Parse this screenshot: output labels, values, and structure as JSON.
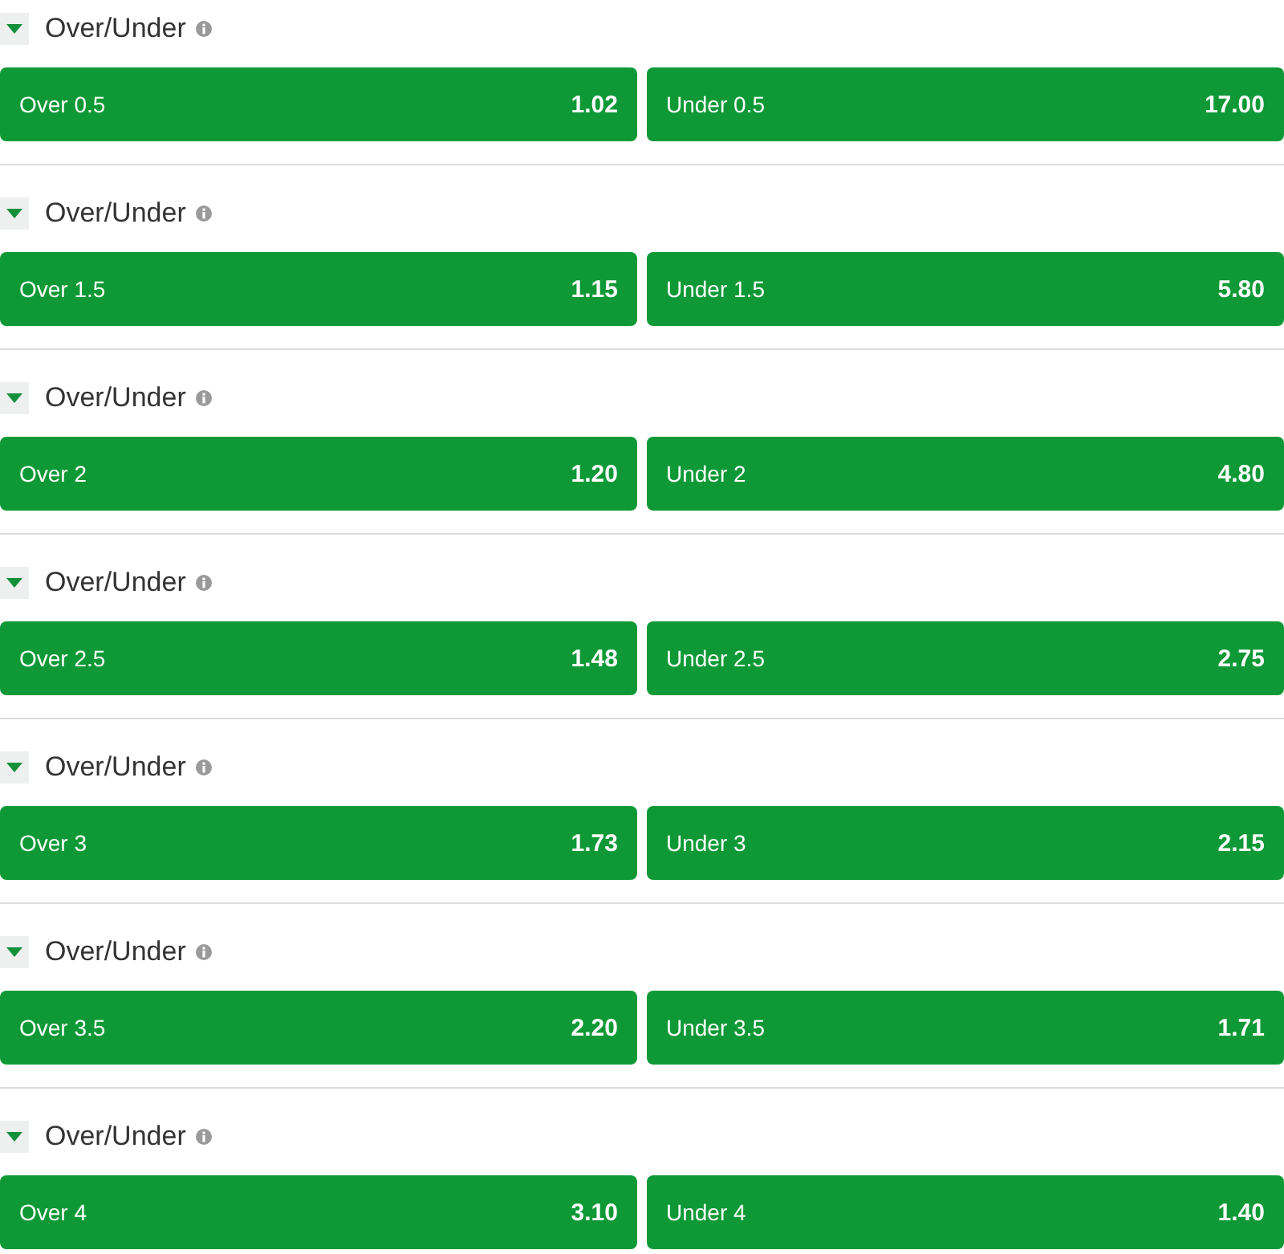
{
  "markets": [
    {
      "title": "Over/Under",
      "expanded": true,
      "outcomes": [
        {
          "label": "Over 0.5",
          "odds": "1.02"
        },
        {
          "label": "Under 0.5",
          "odds": "17.00"
        }
      ]
    },
    {
      "title": "Over/Under",
      "expanded": true,
      "outcomes": [
        {
          "label": "Over 1.5",
          "odds": "1.15"
        },
        {
          "label": "Under 1.5",
          "odds": "5.80"
        }
      ]
    },
    {
      "title": "Over/Under",
      "expanded": true,
      "outcomes": [
        {
          "label": "Over 2",
          "odds": "1.20"
        },
        {
          "label": "Under 2",
          "odds": "4.80"
        }
      ]
    },
    {
      "title": "Over/Under",
      "expanded": true,
      "outcomes": [
        {
          "label": "Over 2.5",
          "odds": "1.48"
        },
        {
          "label": "Under 2.5",
          "odds": "2.75"
        }
      ]
    },
    {
      "title": "Over/Under",
      "expanded": true,
      "outcomes": [
        {
          "label": "Over 3",
          "odds": "1.73"
        },
        {
          "label": "Under 3",
          "odds": "2.15"
        }
      ]
    },
    {
      "title": "Over/Under",
      "expanded": true,
      "outcomes": [
        {
          "label": "Over 3.5",
          "odds": "2.20"
        },
        {
          "label": "Under 3.5",
          "odds": "1.71"
        }
      ]
    },
    {
      "title": "Over/Under",
      "expanded": true,
      "outcomes": [
        {
          "label": "Over 4",
          "odds": "3.10"
        },
        {
          "label": "Under 4",
          "odds": "1.40"
        }
      ]
    }
  ]
}
